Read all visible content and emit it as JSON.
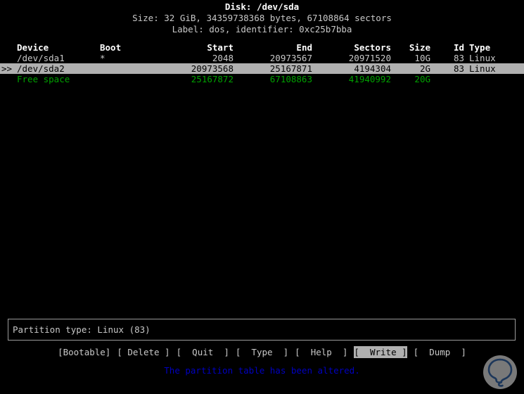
{
  "header": {
    "disk_line": "Disk: /dev/sda",
    "size_line": "Size: 32 GiB, 34359738368 bytes, 67108864 sectors",
    "label_line": "Label: dos, identifier: 0xc25b7bba"
  },
  "table": {
    "columns": {
      "marker": "",
      "device": "Device",
      "boot": "Boot",
      "start": "Start",
      "end": "End",
      "sectors": "Sectors",
      "size": "Size",
      "id": "Id",
      "type": "Type"
    },
    "rows": [
      {
        "marker": "",
        "device": "/dev/sda1",
        "boot": "*",
        "start": "2048",
        "end": "20973567",
        "sectors": "20971520",
        "size": "10G",
        "id": "83",
        "type": "Linux",
        "state": "normal"
      },
      {
        "marker": ">>",
        "device": "/dev/sda2",
        "boot": "",
        "start": "20973568",
        "end": "25167871",
        "sectors": "4194304",
        "size": "2G",
        "id": "83",
        "type": "Linux",
        "state": "selected"
      },
      {
        "marker": "",
        "device": "Free space",
        "boot": "",
        "start": "25167872",
        "end": "67108863",
        "sectors": "41940992",
        "size": "20G",
        "id": "",
        "type": "",
        "state": "free"
      }
    ]
  },
  "type_box": {
    "text": "Partition type: Linux (83)"
  },
  "menu": {
    "items": [
      {
        "label": "[Bootable]",
        "name": "bootable",
        "active": false
      },
      {
        "label": "[ Delete ]",
        "name": "delete",
        "active": false
      },
      {
        "label": "[  Quit  ]",
        "name": "quit",
        "active": false
      },
      {
        "label": "[  Type  ]",
        "name": "type",
        "active": false
      },
      {
        "label": "[  Help  ]",
        "name": "help",
        "active": false
      },
      {
        "label": "[  Write ]",
        "name": "write",
        "active": true
      },
      {
        "label": "[  Dump  ]",
        "name": "dump",
        "active": false
      }
    ]
  },
  "status": {
    "message": "The partition table has been altered."
  },
  "colors": {
    "background": "#000000",
    "foreground": "#c8c8c8",
    "highlight_bg": "#b0b0b0",
    "free_space": "#00a000",
    "status_blue": "#0000c0",
    "watermark_circle": "#808080",
    "watermark_mark": "#1f3a5f"
  },
  "watermark": {
    "icon": "q-lightbulb-logo"
  }
}
